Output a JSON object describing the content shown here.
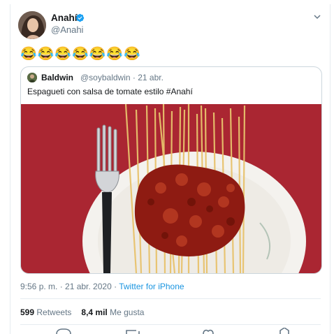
{
  "tweet": {
    "author_name": "Anahí",
    "author_handle": "@Anahi",
    "text": "😂😂😂😂😂😂😂",
    "timestamp": "9:56 p. m. · 21 abr. 2020 · ",
    "source": "Twitter for iPhone",
    "retweets_count": "599",
    "retweets_label": "Retweets",
    "likes_count": "8,4 mil",
    "likes_label": "Me gusta"
  },
  "quoted_tweet": {
    "author_name": "Baldwin",
    "author_handle": "@soybaldwin · 21 abr.",
    "text": "Espagueti con salsa de tomate estilo #Anahí"
  },
  "colors": {
    "link": "#1b95e0",
    "secondary_text": "#657786",
    "border": "#e6ecf0",
    "verified": "#1da1f2"
  },
  "icons": [
    "verified-badge-icon",
    "chevron-down-icon",
    "reply-icon",
    "retweet-icon",
    "like-icon",
    "share-icon"
  ]
}
